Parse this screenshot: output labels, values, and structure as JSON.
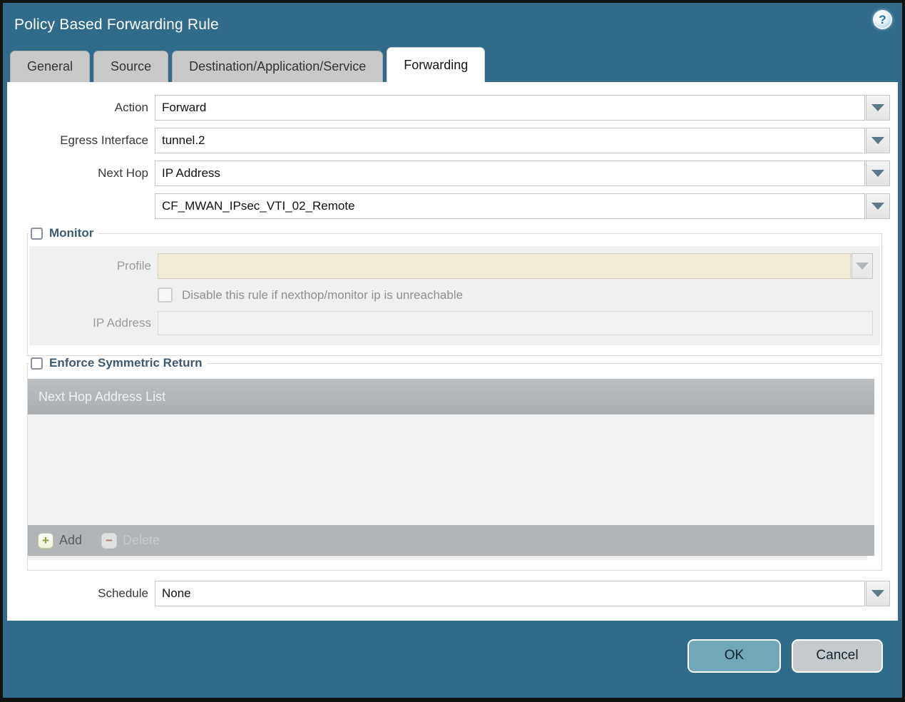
{
  "window": {
    "title": "Policy Based Forwarding Rule"
  },
  "icons": {
    "help": "?",
    "add": "+",
    "delete": "−"
  },
  "tabs": [
    {
      "label": "General",
      "active": false
    },
    {
      "label": "Source",
      "active": false
    },
    {
      "label": "Destination/Application/Service",
      "active": false
    },
    {
      "label": "Forwarding",
      "active": true
    }
  ],
  "form": {
    "action_label": "Action",
    "action_value": "Forward",
    "egress_label": "Egress Interface",
    "egress_value": "tunnel.2",
    "next_hop_label": "Next Hop",
    "next_hop_value": "IP Address",
    "next_hop_address_value": "CF_MWAN_IPsec_VTI_02_Remote",
    "schedule_label": "Schedule",
    "schedule_value": "None"
  },
  "monitor": {
    "legend": "Monitor",
    "checked": false,
    "profile_label": "Profile",
    "profile_value": "",
    "disable_checkbox_label": "Disable this rule if nexthop/monitor ip is unreachable",
    "disable_checkbox_checked": false,
    "ip_label": "IP Address",
    "ip_value": ""
  },
  "symmetric_return": {
    "legend": "Enforce Symmetric Return",
    "checked": false,
    "table_header": "Next Hop Address List",
    "rows": [],
    "add_label": "Add",
    "delete_label": "Delete"
  },
  "buttons": {
    "ok": "OK",
    "cancel": "Cancel"
  },
  "colors": {
    "titlebar_bg": "#306b8a",
    "active_tab_bg": "#ffffff",
    "inactive_tab_bg": "#c9c9c9",
    "table_header_bg": "#b1b5b8",
    "ok_button_bg": "#72a7ba",
    "cancel_button_bg": "#c7cacc",
    "disabled_profile_bg": "#f1ebd7",
    "legend_text": "#3d5a73"
  }
}
